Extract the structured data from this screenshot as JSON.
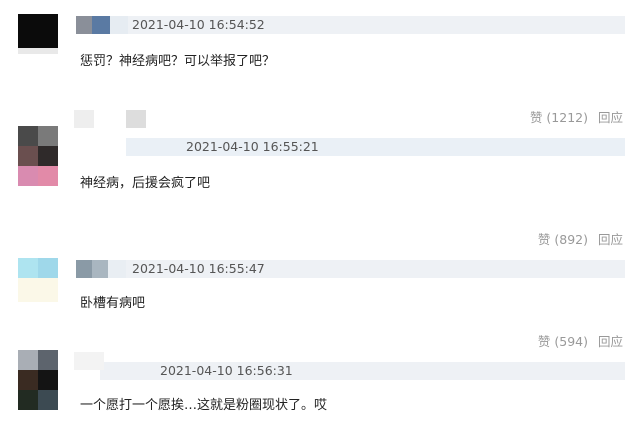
{
  "comments": [
    {
      "timestamp": "2021-04-10 16:54:52",
      "text": "惩罚？神经病吧？可以举报了吧？",
      "like_label": "赞 (1212)",
      "reply_label": "回应"
    },
    {
      "timestamp": "2021-04-10 16:55:21",
      "text": "神经病，后援会疯了吧",
      "like_label": "赞 (892)",
      "reply_label": "回应"
    },
    {
      "timestamp": "2021-04-10 16:55:47",
      "text": "卧槽有病吧",
      "like_label": "赞 (594)",
      "reply_label": "回应"
    },
    {
      "timestamp": "2021-04-10 16:56:31",
      "text": "一个愿打一个愿挨…这就是粉圈现状了。哎"
    }
  ]
}
